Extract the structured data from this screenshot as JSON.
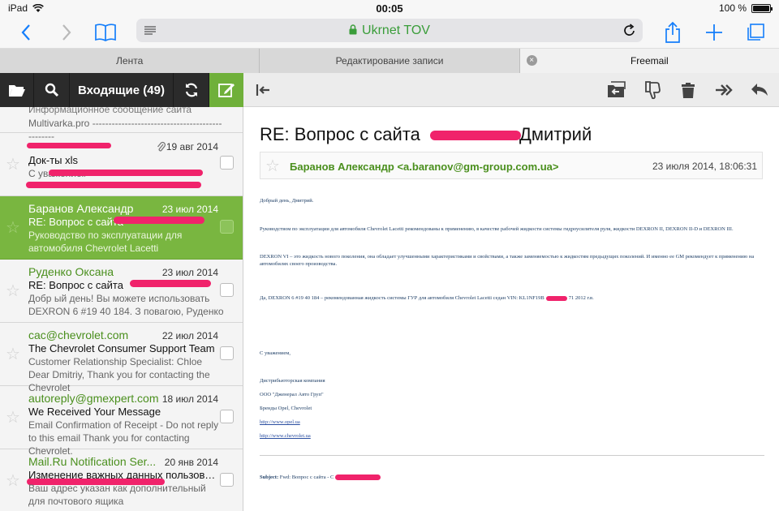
{
  "status_bar": {
    "device": "iPad",
    "time": "00:05",
    "battery": "100 %",
    "battery_level": 1.0
  },
  "browser": {
    "url_title": "Ukrnet TOV"
  },
  "tabs": [
    {
      "label": "Лента"
    },
    {
      "label": "Редактирование записи"
    },
    {
      "label": "Freemail",
      "active": true
    }
  ],
  "mail_toolbar": {
    "folder_title": "Входящие (49)"
  },
  "messages": [
    {
      "sender": "",
      "date": "",
      "subject": "Информационное сообщение сайта",
      "preview": "Multivarka.pro ------------------------------------------------"
    },
    {
      "sender": "",
      "date": "19 авг 2014",
      "subject": "Док-ты xls",
      "preview": "С уважением,"
    },
    {
      "sender": "Баранов Александр",
      "date": "23 июл 2014",
      "subject": "RE: Вопрос с сайта",
      "preview": "Руководство по эксплуатации для автомобиля Chevrolet Lacetti"
    },
    {
      "sender": "Руденко Оксана",
      "date": "23 июл 2014",
      "subject": "RE: Вопрос с сайта",
      "preview": "Добр ый день! Вы можете использовать DEXRON 6 #19 40 184. З повагою, Руденко"
    },
    {
      "sender": "cac@chevrolet.com",
      "date": "22 июл 2014",
      "subject": "The Chevrolet Consumer Support Team",
      "preview": "Customer Relationship Specialist: Chloe Dear Dmitriy, Thank you for contacting the Chevrolet"
    },
    {
      "sender": "autoreply@gmexpert.com",
      "date": "18 июл 2014",
      "subject": "We Received Your Message",
      "preview": "Email Confirmation of Receipt - Do not reply to this email Thank you for contacting Chevrolet."
    },
    {
      "sender": "Mail.Ru Notification Ser...",
      "date": "20 янв 2014",
      "subject": "Изменение важных данных пользовате...",
      "preview": "Ваш адрес указан как дополнительный для почтового ящика"
    }
  ],
  "reader": {
    "subject": "RE: Вопрос с сайта",
    "subject_tail": "Дмитрий",
    "from": "Баранов Александр <a.baranov@gm-group.com.ua>",
    "date": "23 июля 2014, 18:06:31",
    "body": {
      "greeting": "Добрый день, Дмитрий.",
      "p1": "Руководством по эксплуатации для автомобиля Chevrolet Lacetti рекомендованы к применению, в качестве рабочей жидкости системы гидроусилителя руля, жидкости DEXRON II, DEXRON II-D и DEXRON III.",
      "p2": "DEXRON VI – это жидкость нового поколения, она обладает улучшенными характеристиками и свойствами, а также заменяемостью к жидкостям предыдущих поколений. И именно ее GM рекомендует к применению на автомобилях своего производства.",
      "p3a": "Да, DEXRON 6 #19 40 184 – рекомендованная жидкость системы ГУР для автомобиля Chevrolet Lacetti седан VIN: KL1NF19B",
      "p3b": "71 2012 г.в.",
      "regards": "С уважением,",
      "sig1": "Дистрибьюторская компания",
      "sig2": "ООО \"Дженерал Авто Груп\"",
      "sig3": "Бренды Opel, Chevrolet",
      "link1": "http://www.opel.ua",
      "link2": "http://www.chevrolet.ua",
      "fwd_label": "Subject:",
      "fwd_text": "Fwd: Вопрос с сайта - С"
    }
  },
  "colors": {
    "accent_green": "#79b640",
    "sender_green": "#4a8f1d",
    "redaction": "#f0236b",
    "ios_blue": "#147efb"
  }
}
